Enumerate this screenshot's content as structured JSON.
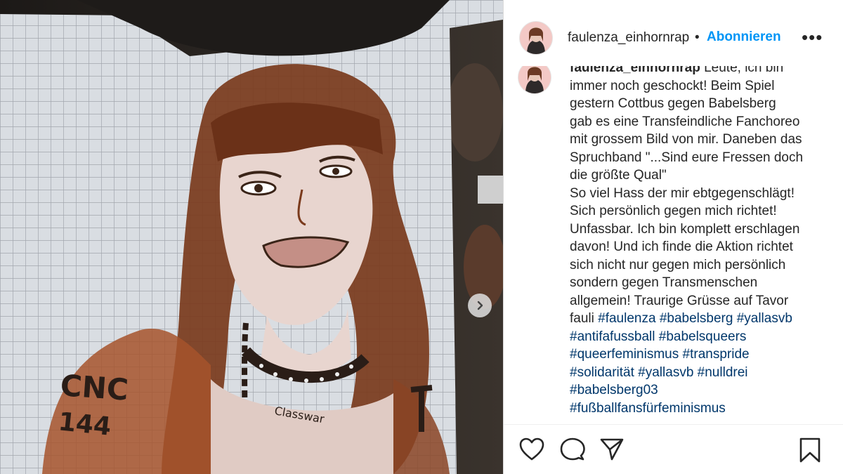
{
  "post": {
    "username": "faulenza_einhornrap",
    "dot": "•",
    "follow_label": "Abonnieren",
    "more_icon": "more-options-icon",
    "caption": {
      "username": "faulenza_einhornrap",
      "lines": [
        "Leute, ich bin",
        "immer noch geschockt! Beim Spiel",
        "gestern Cottbus gegen Babelsberg",
        "gab es eine Transfeindliche Fanchoreo",
        "mit grossem Bild von mir. Daneben das",
        "Spruchband \"...Sind eure Fressen doch",
        "die größte Qual\"",
        "So viel Hass der mir ebtgegenschlägt!",
        "Sich persönlich gegen mich richtet!",
        "Unfassbar. Ich bin komplett erschlagen",
        "davon! Und ich finde die Aktion richtet",
        "sich nicht nur gegen mich persönlich",
        "sondern gegen Transmenschen",
        "allgemein! Traurige Grüsse auf Tavor",
        "fauli"
      ],
      "hashtags": [
        "#faulenza",
        "#babelsberg",
        "#yallasvb",
        "#antifafussball",
        "#babelsqueers",
        "#queerfeminismus",
        "#transpride",
        "#solidarität",
        "#yallasvb",
        "#nulldrei",
        "#babelsberg03",
        "#fußballfansfürfeminismus"
      ]
    },
    "banner_text": {
      "cnc": "CNC",
      "num": "144",
      "necklace": "Classwar"
    }
  },
  "colors": {
    "link": "#0095f6",
    "hashtag": "#00376b",
    "text": "#262626",
    "paint": "#7a3a1c"
  },
  "icons": [
    "heart-icon",
    "comment-icon",
    "share-icon",
    "bookmark-icon",
    "chevron-right-icon"
  ]
}
